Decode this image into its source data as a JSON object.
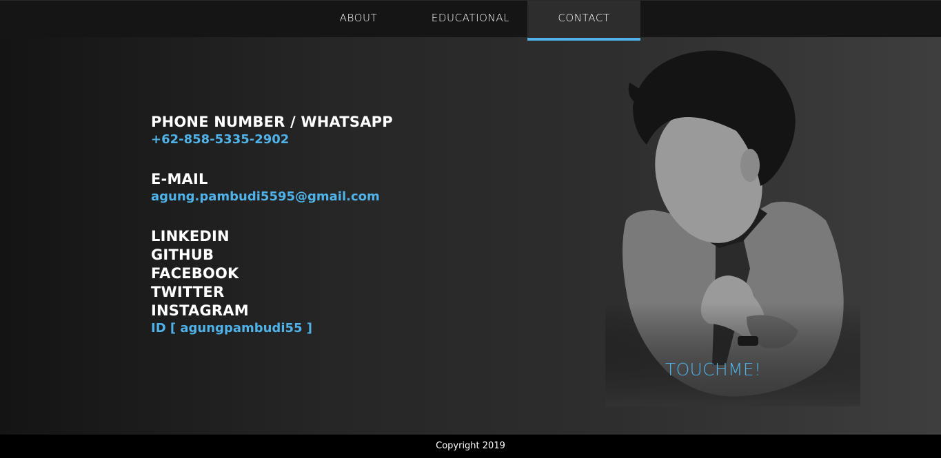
{
  "nav": {
    "items": [
      {
        "label": "ABOUT"
      },
      {
        "label": "EDUCATIONAL"
      },
      {
        "label": "CONTACT"
      }
    ],
    "active": "CONTACT",
    "accent_color": "#4fb3ea"
  },
  "contact": {
    "phone_heading": "PHONE NUMBER / WHATSAPP",
    "phone_value": "+62-858-5335-2902",
    "email_heading": "E-MAIL",
    "email_value": "agung.pambudi5595@gmail.com",
    "socials": [
      "LINKEDIN",
      "GITHUB",
      "FACEBOOK",
      "TWITTER",
      "INSTAGRAM"
    ],
    "social_id": "ID [ agungpambudi55 ]"
  },
  "photo": {
    "overlay_text": "TOUCHME!"
  },
  "footer": {
    "copyright": "Copyright 2019"
  }
}
